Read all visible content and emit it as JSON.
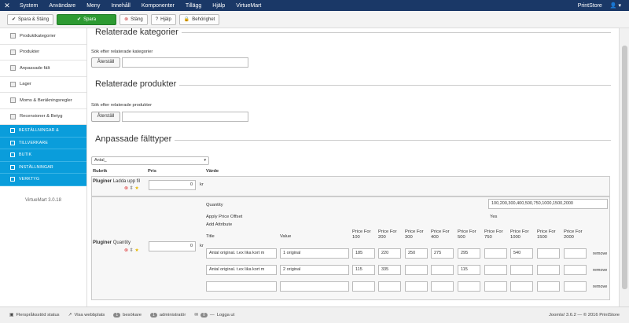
{
  "topbar": {
    "menu": [
      "System",
      "Användare",
      "Meny",
      "Innehåll",
      "Komponenter",
      "Tillägg",
      "Hjälp",
      "VirtueMart"
    ],
    "site": "PrintStore",
    "user": "▾"
  },
  "toolbar": {
    "save_close": "Spara & Stäng",
    "save": "Spara",
    "close": "Stäng",
    "help": "Hjälp",
    "permissions": "Behörighet"
  },
  "sidebar": {
    "items": [
      "Produktkategorier",
      "Produkter",
      "Anpassade fält",
      "Lager",
      "Moms & Beräkningsregler",
      "Recensioner & Betyg"
    ],
    "groups": [
      "BESTÄLLNINGAR &",
      "TILLVERKARE",
      "BUTIK",
      "INSTÄLLNINGAR",
      "VERKTYG"
    ],
    "version": "VirtueMart 3.0.18"
  },
  "main": {
    "related_categories": {
      "title": "Relaterade kategorier",
      "search_label": "Sök efter relaterade kategorier",
      "reset": "Återställ",
      "value": ""
    },
    "related_products": {
      "title": "Relaterade produkter",
      "search_label": "Sök efter relaterade produkter",
      "reset": "Återställ",
      "value": ""
    },
    "custom_fields": {
      "title": "Anpassade fälttyper",
      "select": "Antal_",
      "headers": {
        "rubrik": "Rubrik",
        "pris": "Pris",
        "varde": "Värde"
      },
      "row1": {
        "type": "Pluginer",
        "name": "Ladda upp fil",
        "price": "0",
        "unit": "kr"
      },
      "row2": {
        "type": "Pluginer",
        "name": "Quantity",
        "price": "0",
        "unit": "kr"
      },
      "quantity_label": "Quantity",
      "quantity_value": "100,200,300,400,500,750,1000,1500,2000",
      "apply_offset": "Apply Price Offset",
      "apply_offset_value": "Yes",
      "add_attribute": "Add Attribute",
      "col_title": "Title",
      "col_value": "Value",
      "price_cols": [
        [
          "Price For",
          "100"
        ],
        [
          "Price For",
          "200"
        ],
        [
          "Price For",
          "300"
        ],
        [
          "Price For",
          "400"
        ],
        [
          "Price For",
          "500"
        ],
        [
          "Price For",
          "750"
        ],
        [
          "Price For",
          "1000"
        ],
        [
          "Price For",
          "1500"
        ],
        [
          "Price For",
          "2000"
        ]
      ],
      "attr_rows": [
        {
          "title": "Antal original. t.ex lika kort m",
          "value": "1 original",
          "prices": [
            "185",
            "220",
            "250",
            "275",
            "295",
            "",
            "540",
            "",
            ""
          ],
          "remove": "remove"
        },
        {
          "title": "Antal original. t.ex lika kort m",
          "value": "2 original",
          "prices": [
            "115",
            "335",
            "",
            "",
            "115",
            "",
            "",
            "",
            ""
          ],
          "remove": "remove"
        },
        {
          "title": "",
          "value": "",
          "prices": [
            "",
            "",
            "",
            "",
            "",
            "",
            "",
            "",
            ""
          ],
          "remove": "remove"
        }
      ]
    }
  },
  "statusbar": {
    "multilang": "Flerspråksstöd status",
    "view_site": "Visa webbplats",
    "visitors_count": "1",
    "visitors": "besökare",
    "admins_count": "1",
    "admins": "administratör",
    "messages_count": "0",
    "logout": "Logga ut",
    "footer": "Joomla! 3.6.2 — © 2016 PrintStore"
  }
}
